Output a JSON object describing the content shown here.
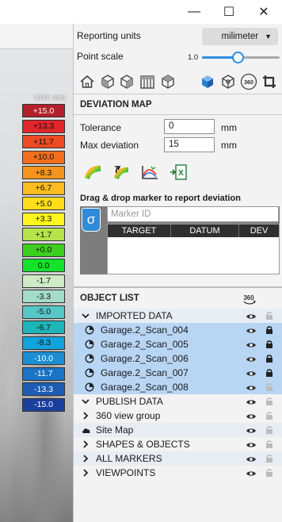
{
  "window": {
    "minimize_label": "—",
    "maximize_label": "☐",
    "close_label": "✕"
  },
  "viewport": {
    "unit_label": "Unit: mm",
    "scale": [
      {
        "label": "+15.0",
        "color": "#b3202a"
      },
      {
        "label": "+13.3",
        "color": "#e0252b"
      },
      {
        "label": "+11.7",
        "color": "#ee4a23"
      },
      {
        "label": "+10.0",
        "color": "#f36f1d"
      },
      {
        "label": "+8.3",
        "color": "#f7941d"
      },
      {
        "label": "+6.7",
        "color": "#fbbb21"
      },
      {
        "label": "+5.0",
        "color": "#ffdd1c"
      },
      {
        "label": "+3.3",
        "color": "#fff51e"
      },
      {
        "label": "+1.7",
        "color": "#b4e34a"
      },
      {
        "label": "+0.0",
        "color": "#3ccf1e"
      },
      {
        "label": "0.0",
        "color": "#14e22b"
      },
      {
        "label": "-1.7",
        "color": "#ccebc6"
      },
      {
        "label": "-3.3",
        "color": "#a3dcc8"
      },
      {
        "label": "-5.0",
        "color": "#56c7c6"
      },
      {
        "label": "-6.7",
        "color": "#1db5b7"
      },
      {
        "label": "-8.3",
        "color": "#11a3dc"
      },
      {
        "label": "-10.0",
        "color": "#1c8ed2"
      },
      {
        "label": "-11.7",
        "color": "#1a74c5"
      },
      {
        "label": "-13.3",
        "color": "#1c5cb3"
      },
      {
        "label": "-15.0",
        "color": "#1b3f9d"
      }
    ]
  },
  "settings": {
    "reporting_units_label": "Reporting units",
    "reporting_units_value": "milimeter",
    "point_scale_label": "Point scale",
    "point_scale_value": "1.0",
    "point_scale_fraction": 0.46
  },
  "toolbar": {
    "icons": [
      "home-icon",
      "cube-front-icon",
      "cube-side-icon",
      "cube-top-icon",
      "cube-iso-icon",
      "solid-cube-icon",
      "wire-cube-icon",
      "view-360-icon",
      "crop-icon"
    ],
    "view_360_label": "360"
  },
  "deviation_map": {
    "title": "DEVIATION MAP",
    "tolerance_label": "Tolerance",
    "tolerance_value": "0",
    "tolerance_unit": "mm",
    "max_deviation_label": "Max deviation",
    "max_deviation_value": "15",
    "max_deviation_unit": "mm",
    "drag_drop_label": "Drag & drop marker to report deviation",
    "marker_icon_glyph": "σ",
    "marker_id_placeholder": "Marker ID",
    "columns": [
      "TARGET",
      "DATUM",
      "DEV"
    ]
  },
  "object_list": {
    "title": "OBJECT LIST",
    "view_360_label": "360",
    "rows": [
      {
        "label": "IMPORTED DATA",
        "kind": "group",
        "expanded": true,
        "style": "alt"
      },
      {
        "label": "Garage.2_Scan_004",
        "kind": "scan",
        "style": "sel",
        "locked": true
      },
      {
        "label": "Garage.2_Scan_005",
        "kind": "scan",
        "style": "sel",
        "locked": true
      },
      {
        "label": "Garage.2_Scan_006",
        "kind": "scan",
        "style": "sel",
        "locked": true
      },
      {
        "label": "Garage.2_Scan_007",
        "kind": "scan",
        "style": "sel",
        "locked": true
      },
      {
        "label": "Garage.2_Scan_008",
        "kind": "scan",
        "style": "sel",
        "locked": false
      },
      {
        "label": "PUBLISH DATA",
        "kind": "group",
        "expanded": true,
        "style": "plain"
      },
      {
        "label": "360 view group",
        "kind": "subgroup",
        "style": "plain"
      },
      {
        "label": "Site Map",
        "kind": "cloud",
        "style": "alt"
      },
      {
        "label": "SHAPES & OBJECTS",
        "kind": "group",
        "expanded": false,
        "style": "plain"
      },
      {
        "label": "ALL MARKERS",
        "kind": "group",
        "expanded": false,
        "style": "alt"
      },
      {
        "label": "VIEWPOINTS",
        "kind": "group",
        "expanded": false,
        "style": "plain"
      }
    ]
  }
}
